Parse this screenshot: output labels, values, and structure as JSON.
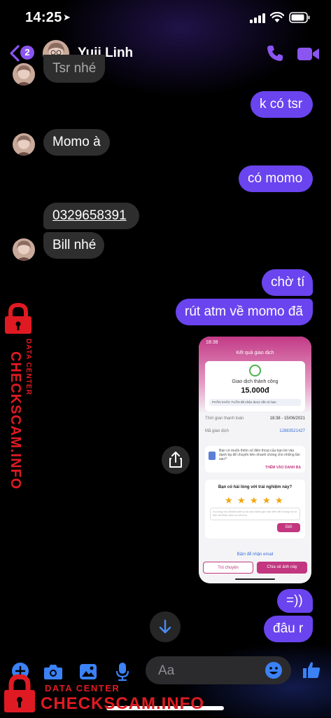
{
  "status_bar": {
    "time": "14:25"
  },
  "header": {
    "unread_count": "2",
    "contact_name": "Yuii Linh"
  },
  "messages": {
    "partial_top": "Tsr nhé",
    "m1": "k có tsr",
    "m2": "Momo à",
    "m3": "có momo",
    "m4": "0329658391",
    "m5": "Bill nhé",
    "m6": "chờ tí",
    "m7": "rút atm về momo đã",
    "m8": "=))",
    "m9": "đâu r"
  },
  "shared_screenshot": {
    "time": "18:38",
    "title": "Kết quả giao dịch",
    "status": "Giao dịch thành công",
    "amount": "15.000đ",
    "promo": "PHẦN KHẮC TUẦN đã nhận được tiền từ bạn",
    "time_label": "Thời gian thanh toán",
    "time_value": "18:38 - 15/06/2021",
    "code_label": "Mã giao dịch",
    "code_value": "12883521427",
    "contact_text": "Bạn có muốn thêm số điện thoại của bạn bè vào danh bạ để chuyển tiền nhanh chóng cho những lần sau?",
    "contact_action": "THÊM VÀO DANH BẠ",
    "rating_question": "Bạn có hài lòng với trải nghiệm này?",
    "rating_placeholder": "Vui lòng cho MoMo biết lý do bạn đánh giá như trên để chúng tôi có thể cải thiện dịch vụ tốt hơn",
    "send_label": "Gửi",
    "email_label": "Bấm để nhận email",
    "chat_label": "Trò chuyện",
    "share_label": "Chia sẻ ảnh này"
  },
  "composer": {
    "placeholder": "Aa"
  },
  "watermark": {
    "label": "DATA CENTER",
    "brand": "CHECKSCAM.INFO"
  },
  "colors": {
    "outgoing_bubble": "#6a44ef",
    "incoming_bubble": "#2e2e2e",
    "accent": "#8a55f0",
    "watermark": "#e01a22"
  },
  "icons": [
    "back-chevron-icon",
    "phone-icon",
    "video-icon",
    "share-icon",
    "scroll-down-icon",
    "add-icon",
    "camera-icon",
    "gallery-icon",
    "mic-icon",
    "emoji-icon",
    "like-icon"
  ]
}
